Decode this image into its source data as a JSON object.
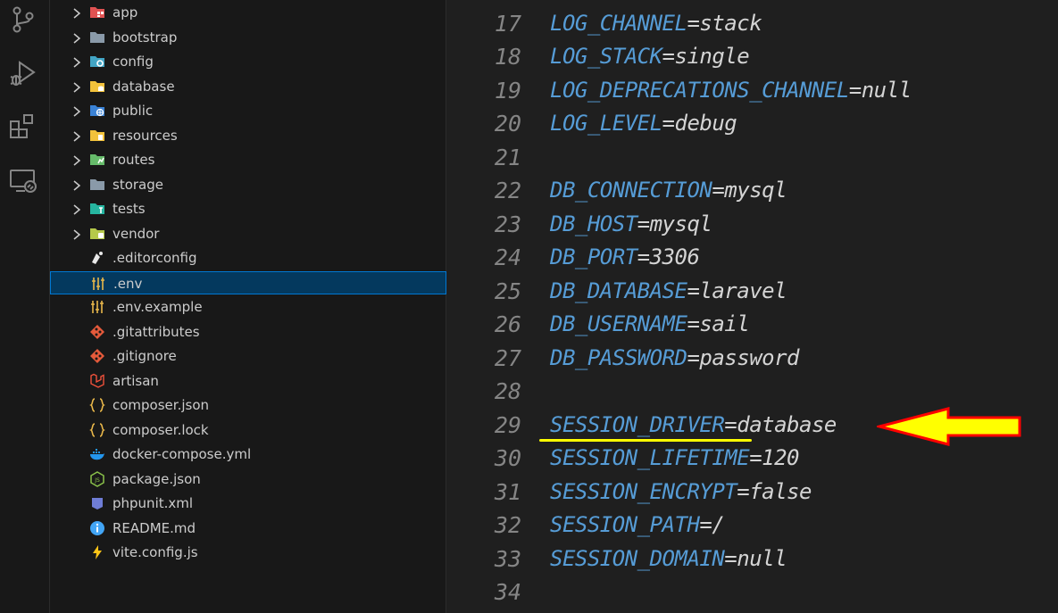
{
  "explorer": {
    "items": [
      {
        "label": "app",
        "folder": true,
        "icon": "app-folder-icon",
        "color": "#e05252"
      },
      {
        "label": "bootstrap",
        "folder": true,
        "icon": "folder-icon",
        "color": "#8a9aa9"
      },
      {
        "label": "config",
        "folder": true,
        "icon": "config-folder-icon",
        "color": "#42a5c5"
      },
      {
        "label": "database",
        "folder": true,
        "icon": "database-folder-icon",
        "color": "#f2c23b"
      },
      {
        "label": "public",
        "folder": true,
        "icon": "public-folder-icon",
        "color": "#3a82d6"
      },
      {
        "label": "resources",
        "folder": true,
        "icon": "resources-folder-icon",
        "color": "#f2c23b"
      },
      {
        "label": "routes",
        "folder": true,
        "icon": "routes-folder-icon",
        "color": "#66bb6a"
      },
      {
        "label": "storage",
        "folder": true,
        "icon": "folder-icon",
        "color": "#8a9aa9"
      },
      {
        "label": "tests",
        "folder": true,
        "icon": "tests-folder-icon",
        "color": "#26b5a0"
      },
      {
        "label": "vendor",
        "folder": true,
        "icon": "vendor-folder-icon",
        "color": "#b5c94a"
      },
      {
        "label": ".editorconfig",
        "folder": false,
        "icon": "editorconfig-icon",
        "color": "#e8e8e8"
      },
      {
        "label": ".env",
        "folder": false,
        "icon": "env-settings-icon",
        "color": "#e8b74a",
        "selected": true
      },
      {
        "label": ".env.example",
        "folder": false,
        "icon": "env-settings-icon",
        "color": "#e8b74a"
      },
      {
        "label": ".gitattributes",
        "folder": false,
        "icon": "git-icon",
        "color": "#e65a3b"
      },
      {
        "label": ".gitignore",
        "folder": false,
        "icon": "git-icon",
        "color": "#e65a3b"
      },
      {
        "label": "artisan",
        "folder": false,
        "icon": "laravel-icon",
        "color": "#f0513b"
      },
      {
        "label": "composer.json",
        "folder": false,
        "icon": "json-braces-icon",
        "color": "#e8b74a"
      },
      {
        "label": "composer.lock",
        "folder": false,
        "icon": "json-braces-icon",
        "color": "#e8b74a"
      },
      {
        "label": "docker-compose.yml",
        "folder": false,
        "icon": "docker-icon",
        "color": "#2496ed"
      },
      {
        "label": "package.json",
        "folder": false,
        "icon": "nodejs-icon",
        "color": "#8bc34a"
      },
      {
        "label": "phpunit.xml",
        "folder": false,
        "icon": "phpunit-icon",
        "color": "#6f7dd6"
      },
      {
        "label": "README.md",
        "folder": false,
        "icon": "info-icon",
        "color": "#42a5f5"
      },
      {
        "label": "vite.config.js",
        "folder": false,
        "icon": "vite-bolt-icon",
        "color": "#ffc517"
      }
    ]
  },
  "editor": {
    "lines": [
      {
        "n": "17",
        "key": "LOG_CHANNEL",
        "eq": "=",
        "val": "stack"
      },
      {
        "n": "18",
        "key": "LOG_STACK",
        "eq": "=",
        "val": "single"
      },
      {
        "n": "19",
        "key": "LOG_DEPRECATIONS_CHANNEL",
        "eq": "=",
        "val": "null"
      },
      {
        "n": "20",
        "key": "LOG_LEVEL",
        "eq": "=",
        "val": "debug"
      },
      {
        "n": "21",
        "key": "",
        "eq": "",
        "val": ""
      },
      {
        "n": "22",
        "key": "DB_CONNECTION",
        "eq": "=",
        "val": "mysql"
      },
      {
        "n": "23",
        "key": "DB_HOST",
        "eq": "=",
        "val": "mysql"
      },
      {
        "n": "24",
        "key": "DB_PORT",
        "eq": "=",
        "val": "3306"
      },
      {
        "n": "25",
        "key": "DB_DATABASE",
        "eq": "=",
        "val": "laravel"
      },
      {
        "n": "26",
        "key": "DB_USERNAME",
        "eq": "=",
        "val": "sail"
      },
      {
        "n": "27",
        "key": "DB_PASSWORD",
        "eq": "=",
        "val": "password"
      },
      {
        "n": "28",
        "key": "",
        "eq": "",
        "val": ""
      },
      {
        "n": "29",
        "key": "SESSION_DRIVER",
        "eq": "=",
        "val": "database"
      },
      {
        "n": "30",
        "key": "SESSION_LIFETIME",
        "eq": "=",
        "val": "120"
      },
      {
        "n": "31",
        "key": "SESSION_ENCRYPT",
        "eq": "=",
        "val": "false"
      },
      {
        "n": "32",
        "key": "SESSION_PATH",
        "eq": "=",
        "val": "/"
      },
      {
        "n": "33",
        "key": "SESSION_DOMAIN",
        "eq": "=",
        "val": "null"
      },
      {
        "n": "34",
        "key": "",
        "eq": "",
        "val": ""
      }
    ]
  },
  "annotation": {
    "highlight_color": "#ffff00",
    "arrow_color": "#ffff00",
    "arrow_outline": "#ff0000"
  }
}
